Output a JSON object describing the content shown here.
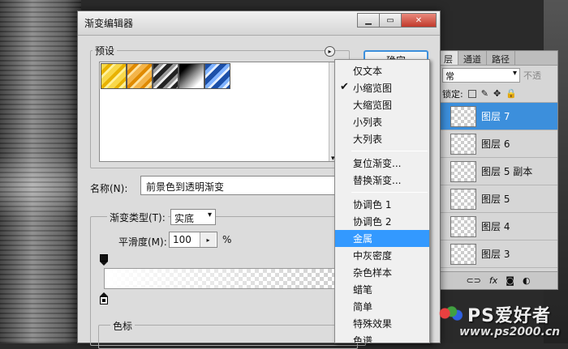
{
  "layers_panel": {
    "tabs": [
      "层",
      "通道",
      "路径"
    ],
    "mode": "常",
    "opacity_label": "不透",
    "lock_label": "锁定:",
    "layers": [
      {
        "name": "图层 7",
        "selected": true
      },
      {
        "name": "图层 6",
        "selected": false
      },
      {
        "name": "图层 5 副本",
        "selected": false
      },
      {
        "name": "图层 5",
        "selected": false
      },
      {
        "name": "图层 4",
        "selected": false
      },
      {
        "name": "图层 3",
        "selected": false
      }
    ],
    "bottom_icons": [
      "link-icon",
      "fx-icon",
      "mask-icon",
      "adjustment-icon"
    ],
    "selected_color": "#3c8fdc"
  },
  "dialog": {
    "title": "渐变编辑器",
    "presets_label": "预设",
    "ok_label": "确定",
    "name_label": "名称(N):",
    "name_value": "前景色到透明渐变",
    "gradient_type_label": "渐变类型(T):",
    "gradient_type_value": "实底",
    "smoothness_label": "平滑度(M):",
    "smoothness_value": "100",
    "smoothness_unit": "%",
    "color_stops_label": "色标",
    "presets": [
      "gold",
      "orange-metal",
      "silver",
      "black-white",
      "blue-metal"
    ]
  },
  "menu": {
    "items": [
      {
        "label": "仅文本",
        "checked": false,
        "highlighted": false
      },
      {
        "label": "小缩览图",
        "checked": true,
        "highlighted": false
      },
      {
        "label": "大缩览图",
        "checked": false,
        "highlighted": false
      },
      {
        "label": "小列表",
        "checked": false,
        "highlighted": false
      },
      {
        "label": "大列表",
        "checked": false,
        "highlighted": false
      },
      {
        "sep": true
      },
      {
        "label": "复位渐变...",
        "checked": false,
        "highlighted": false
      },
      {
        "label": "替换渐变...",
        "checked": false,
        "highlighted": false
      },
      {
        "sep": true
      },
      {
        "label": "协调色 1",
        "checked": false,
        "highlighted": false
      },
      {
        "label": "协调色 2",
        "checked": false,
        "highlighted": false
      },
      {
        "label": "金属",
        "checked": false,
        "highlighted": true
      },
      {
        "label": "中灰密度",
        "checked": false,
        "highlighted": false
      },
      {
        "label": "杂色样本",
        "checked": false,
        "highlighted": false
      },
      {
        "label": "蜡笔",
        "checked": false,
        "highlighted": false
      },
      {
        "label": "简单",
        "checked": false,
        "highlighted": false
      },
      {
        "label": "特殊效果",
        "checked": false,
        "highlighted": false
      },
      {
        "label": "色谱",
        "checked": false,
        "highlighted": false
      }
    ],
    "highlight_color": "#3399ff"
  },
  "watermark": {
    "brand": "PS爱好者",
    "url": "www.ps2000.cn"
  }
}
